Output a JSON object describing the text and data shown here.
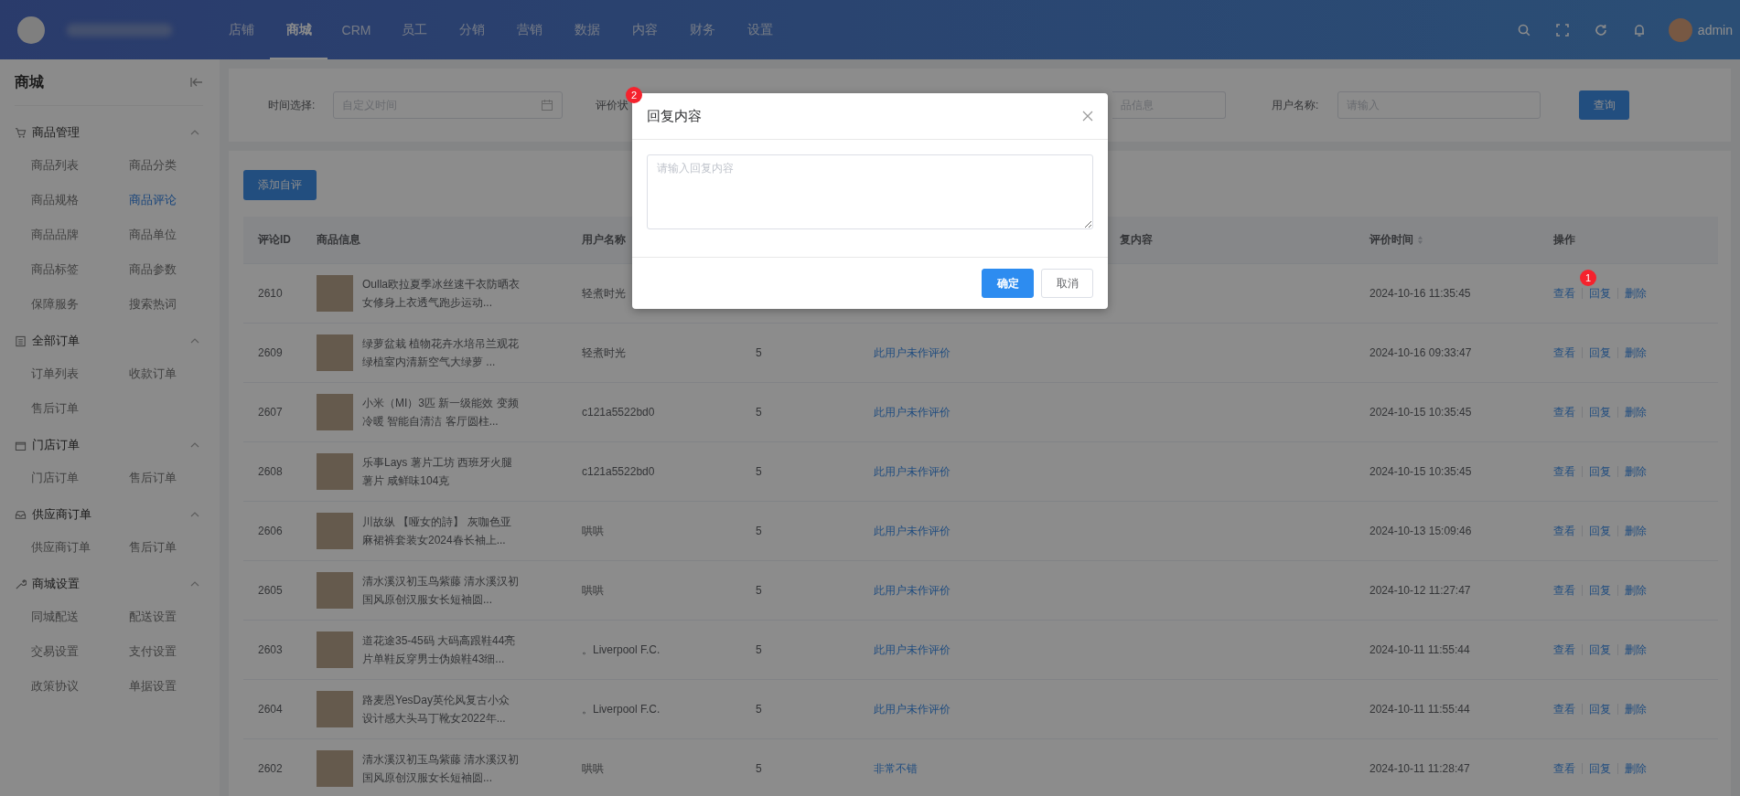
{
  "header": {
    "nav": [
      {
        "label": "店铺",
        "selected": false
      },
      {
        "label": "商城",
        "selected": true
      },
      {
        "label": "CRM",
        "selected": false
      },
      {
        "label": "员工",
        "selected": false
      },
      {
        "label": "分销",
        "selected": false
      },
      {
        "label": "营销",
        "selected": false
      },
      {
        "label": "数据",
        "selected": false
      },
      {
        "label": "内容",
        "selected": false
      },
      {
        "label": "财务",
        "selected": false
      },
      {
        "label": "设置",
        "selected": false
      }
    ],
    "user": "admin"
  },
  "sidebar": {
    "title": "商城",
    "groups": [
      {
        "title": "商品管理",
        "expanded": true,
        "items": [
          {
            "label": "商品列表",
            "selected": false
          },
          {
            "label": "商品分类",
            "selected": false
          },
          {
            "label": "商品规格",
            "selected": false
          },
          {
            "label": "商品评论",
            "selected": true
          },
          {
            "label": "商品品牌",
            "selected": false
          },
          {
            "label": "商品单位",
            "selected": false
          },
          {
            "label": "商品标签",
            "selected": false
          },
          {
            "label": "商品参数",
            "selected": false
          },
          {
            "label": "保障服务",
            "selected": false
          },
          {
            "label": "搜索热词",
            "selected": false
          }
        ]
      },
      {
        "title": "全部订单",
        "expanded": true,
        "items": [
          {
            "label": "订单列表",
            "selected": false
          },
          {
            "label": "收款订单",
            "selected": false
          },
          {
            "label": "售后订单",
            "selected": false
          }
        ]
      },
      {
        "title": "门店订单",
        "expanded": true,
        "items": [
          {
            "label": "门店订单",
            "selected": false
          },
          {
            "label": "售后订单",
            "selected": false
          }
        ]
      },
      {
        "title": "供应商订单",
        "expanded": true,
        "items": [
          {
            "label": "供应商订单",
            "selected": false
          },
          {
            "label": "售后订单",
            "selected": false
          }
        ]
      },
      {
        "title": "商城设置",
        "expanded": true,
        "items": [
          {
            "label": "同城配送",
            "selected": false
          },
          {
            "label": "配送设置",
            "selected": false
          },
          {
            "label": "交易设置",
            "selected": false
          },
          {
            "label": "支付设置",
            "selected": false
          },
          {
            "label": "政策协议",
            "selected": false
          },
          {
            "label": "单据设置",
            "selected": false
          }
        ]
      }
    ]
  },
  "filters": {
    "time_label": "时间选择:",
    "time_placeholder": "自定义时间",
    "status_label": "评价状",
    "product_placeholder": "品信息",
    "user_label": "用户名称:",
    "user_placeholder": "请输入",
    "query_button": "查询"
  },
  "add_button": "添加自评",
  "table": {
    "columns": {
      "id": "评论ID",
      "product": "商品信息",
      "user": "用户名称",
      "reply": "复内容",
      "time": "评价时间",
      "actions": "操作"
    },
    "rows": [
      {
        "id": "2610",
        "product": "Oulla欧拉夏季冰丝速干衣防晒衣女修身上衣透气跑步运动...",
        "user": "轻煮时光",
        "time": "2024-10-16 11:35:45",
        "actions": [
          "查看",
          "回复",
          "删除"
        ],
        "badge": "1"
      },
      {
        "id": "2609",
        "product": "绿萝盆栽 植物花卉水培吊兰观花绿植室内清新空气大绿萝 ...",
        "user": "轻煮时光",
        "score": "5",
        "comment": "此用户未作评价",
        "time": "2024-10-16 09:33:47",
        "actions": [
          "查看",
          "回复",
          "删除"
        ]
      },
      {
        "id": "2607",
        "product": "小米（MI）3匹 新一级能效 变频冷暖 智能自清洁 客厅圆柱...",
        "user": "c121a5522bd0",
        "score": "5",
        "comment": "此用户未作评价",
        "time": "2024-10-15 10:35:45",
        "actions": [
          "查看",
          "回复",
          "删除"
        ]
      },
      {
        "id": "2608",
        "product": "乐事Lays 薯片工坊 西班牙火腿薯片 咸鲜味104克",
        "user": "c121a5522bd0",
        "score": "5",
        "comment": "此用户未作评价",
        "time": "2024-10-15 10:35:45",
        "actions": [
          "查看",
          "回复",
          "删除"
        ]
      },
      {
        "id": "2606",
        "product": "川故纵 【哑女的詩】 灰咖色亚麻裙裤套装女2024春长袖上...",
        "user": "哄哄",
        "score": "5",
        "comment": "此用户未作评价",
        "time": "2024-10-13 15:09:46",
        "actions": [
          "查看",
          "回复",
          "删除"
        ]
      },
      {
        "id": "2605",
        "product": "清水溪汉初玉鸟紫藤 清水溪汉初国风原创汉服女长短袖圆...",
        "user": "哄哄",
        "score": "5",
        "comment": "此用户未作评价",
        "time": "2024-10-12 11:27:47",
        "actions": [
          "查看",
          "回复",
          "删除"
        ]
      },
      {
        "id": "2603",
        "product": "道花途35-45码 大码高跟鞋44亮片单鞋反穿男士伪娘鞋43细...",
        "user": "。Liverpool F.C.",
        "score": "5",
        "comment": "此用户未作评价",
        "time": "2024-10-11 11:55:44",
        "actions": [
          "查看",
          "回复",
          "删除"
        ]
      },
      {
        "id": "2604",
        "product": "路麦恩YesDay英伦风复古小众设计感大头马丁靴女2022年...",
        "user": "。Liverpool F.C.",
        "score": "5",
        "comment": "此用户未作评价",
        "time": "2024-10-11 11:55:44",
        "actions": [
          "查看",
          "回复",
          "删除"
        ]
      },
      {
        "id": "2602",
        "product": "清水溪汉初玉鸟紫藤 清水溪汉初国风原创汉服女长短袖圆...",
        "user": "哄哄",
        "score": "5",
        "comment": "非常不错",
        "time": "2024-10-11 11:28:47",
        "actions": [
          "查看",
          "回复",
          "删除"
        ]
      }
    ]
  },
  "dialog": {
    "title": "回复内容",
    "placeholder": "请输入回复内容",
    "buttons": [
      "确定",
      "取消"
    ],
    "badge": "2"
  }
}
